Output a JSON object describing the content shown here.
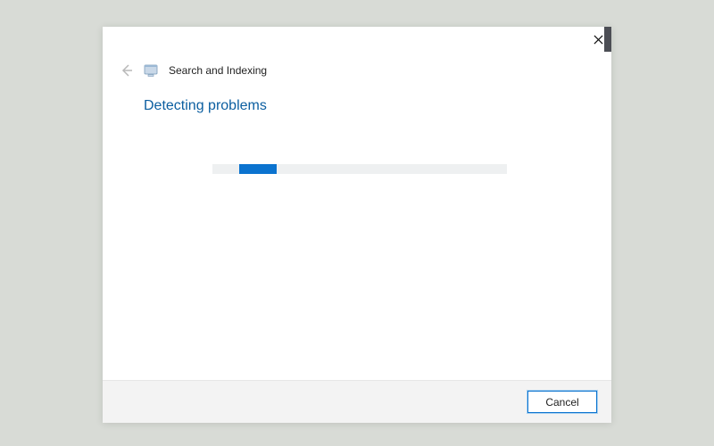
{
  "header": {
    "title": "Search and Indexing"
  },
  "main": {
    "heading": "Detecting problems"
  },
  "footer": {
    "cancel_label": "Cancel"
  }
}
